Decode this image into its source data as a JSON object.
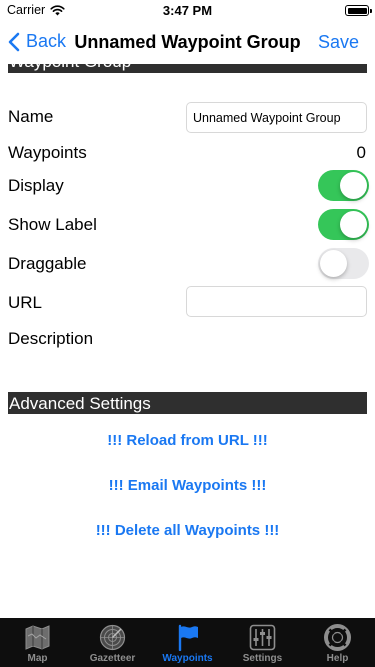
{
  "status_bar": {
    "carrier": "Carrier",
    "time": "3:47 PM"
  },
  "nav": {
    "back_label": "Back",
    "title": "Unnamed Waypoint Group",
    "save_label": "Save"
  },
  "sections": {
    "group_header": "Waypoint Group",
    "advanced_header": "Advanced Settings"
  },
  "form": {
    "name_label": "Name",
    "name_value": "Unnamed Waypoint Group",
    "waypoints_label": "Waypoints",
    "waypoints_count": "0",
    "display_label": "Display",
    "display_on": true,
    "show_label_label": "Show Label",
    "show_label_on": true,
    "draggable_label": "Draggable",
    "draggable_on": false,
    "url_label": "URL",
    "url_value": "",
    "description_label": "Description"
  },
  "actions": {
    "reload": "!!! Reload from URL !!!",
    "email": "!!! Email Waypoints !!!",
    "delete": "!!! Delete all Waypoints !!!"
  },
  "tabs": [
    {
      "label": "Map",
      "icon": "map-icon"
    },
    {
      "label": "Gazetteer",
      "icon": "radar-icon"
    },
    {
      "label": "Waypoints",
      "icon": "flag-icon"
    },
    {
      "label": "Settings",
      "icon": "sliders-icon"
    },
    {
      "label": "Help",
      "icon": "lifebuoy-icon"
    }
  ],
  "active_tab": "Waypoints",
  "colors": {
    "accent": "#1a78f2",
    "toggle_on": "#35c659",
    "header_bg": "#2f2f2f",
    "tabbar_bg": "#0e0e0e"
  }
}
